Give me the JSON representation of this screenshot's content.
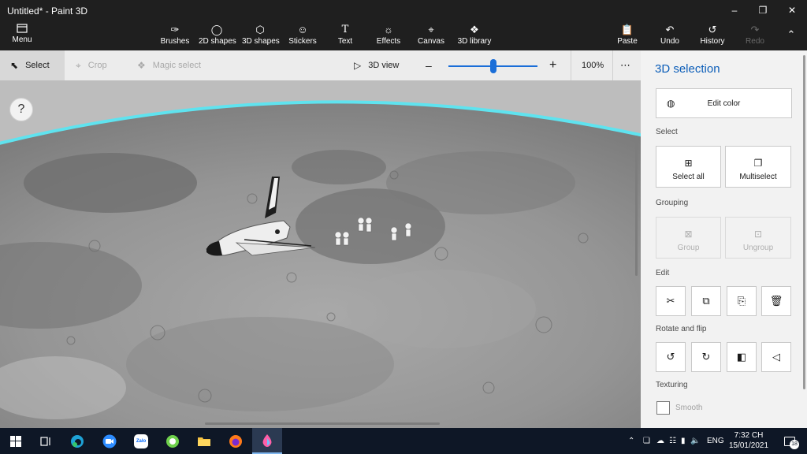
{
  "window": {
    "title": "Untitled* - Paint 3D"
  },
  "ribbon": {
    "menu_label": "Menu",
    "tools": [
      {
        "label": "Brushes",
        "icon": "brush-icon"
      },
      {
        "label": "2D shapes",
        "icon": "2d-shapes-icon"
      },
      {
        "label": "3D shapes",
        "icon": "3d-shapes-icon"
      },
      {
        "label": "Stickers",
        "icon": "stickers-icon"
      },
      {
        "label": "Text",
        "icon": "text-icon"
      },
      {
        "label": "Effects",
        "icon": "effects-icon"
      },
      {
        "label": "Canvas",
        "icon": "canvas-icon"
      },
      {
        "label": "3D library",
        "icon": "3d-library-icon"
      }
    ],
    "paste_label": "Paste",
    "undo_label": "Undo",
    "history_label": "History",
    "redo_label": "Redo"
  },
  "toolbar": {
    "select_label": "Select",
    "crop_label": "Crop",
    "magic_select_label": "Magic select",
    "view_3d_label": "3D view",
    "zoom_value": "100%",
    "zoom_slider_fraction": 0.5
  },
  "canvas": {
    "help_label": "?"
  },
  "panel": {
    "title": "3D selection",
    "edit_color_label": "Edit color",
    "select_section": "Select",
    "select_all_label": "Select all",
    "multiselect_label": "Multiselect",
    "grouping_section": "Grouping",
    "group_label": "Group",
    "ungroup_label": "Ungroup",
    "edit_section": "Edit",
    "rotate_section": "Rotate and flip",
    "texturing_section": "Texturing",
    "smooth_label": "Smooth"
  },
  "taskbar": {
    "time": "7:32 CH",
    "date": "15/01/2021",
    "language": "ENG",
    "notification_count": "18",
    "zalo_label": "Zalo"
  },
  "colors": {
    "accent": "#0b5db8",
    "slider": "#1a6ed8",
    "horizon_glow": "#5fe3ef"
  }
}
